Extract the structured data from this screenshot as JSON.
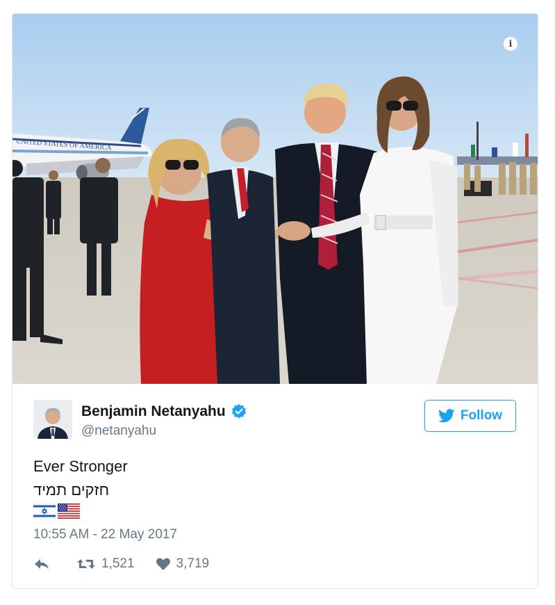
{
  "tweet": {
    "author_name": "Benjamin Netanyahu",
    "author_handle": "@netanyahu",
    "follow_label": "Follow",
    "text_line1": "Ever Stronger",
    "text_line2": "חזקים תמיד",
    "timestamp": "10:55 AM - 22 May 2017",
    "retweets": "1,521",
    "likes": "3,719"
  },
  "photo": {
    "aircraft_text": "UNITED STATES OF AMERICA"
  },
  "colors": {
    "accent": "#1da1f2",
    "text": "#14171a",
    "muted": "#657786"
  },
  "icons": [
    "info-icon",
    "verified-badge-icon",
    "twitter-bird-icon",
    "reply-icon",
    "retweet-icon",
    "heart-icon",
    "israel-flag-icon",
    "us-flag-icon"
  ]
}
